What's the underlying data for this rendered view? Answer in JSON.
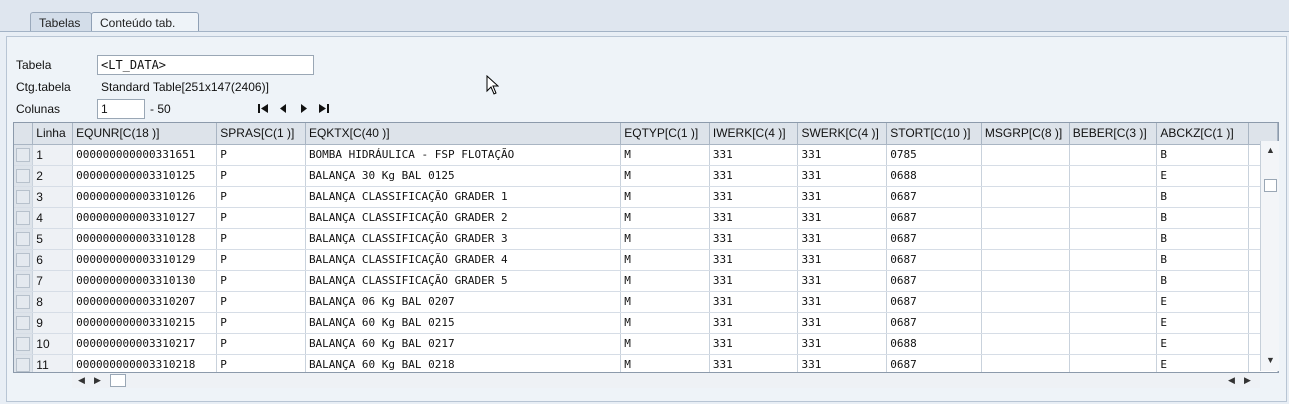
{
  "tabs": [
    {
      "label": "Tabelas"
    },
    {
      "label": "Conteúdo tab."
    }
  ],
  "form": {
    "tabela_label": "Tabela",
    "tabela_value": "<LT_DATA>",
    "ctg_label": "Ctg.tabela",
    "ctg_value": "Standard Table[251x147(2406)]",
    "colunas_label": "Colunas",
    "colunas_value": "1",
    "colunas_to": "-  50"
  },
  "nav_icons": [
    "first-icon",
    "prev-icon",
    "next-icon",
    "last-icon"
  ],
  "table": {
    "columns": [
      "Linha",
      "EQUNR[C(18 )]",
      "SPRAS[C(1 )]",
      "EQKTX[C(40 )]",
      "EQTYP[C(1 )]",
      "IWERK[C(4 )]",
      "SWERK[C(4 )]",
      "STORT[C(10 )]",
      "MSGRP[C(8 )]",
      "BEBER[C(3 )]",
      "ABCKZ[C(1 )]"
    ],
    "rows": [
      [
        "1",
        "000000000000331651",
        "P",
        "BOMBA HIDRÁULICA - FSP FLOTAÇÃO",
        "M",
        "331",
        "331",
        "0785",
        "",
        "",
        "B"
      ],
      [
        "2",
        "000000000003310125",
        "P",
        "BALANÇA 30 Kg BAL 0125",
        "M",
        "331",
        "331",
        "0688",
        "",
        "",
        "E"
      ],
      [
        "3",
        "000000000003310126",
        "P",
        "BALANÇA CLASSIFICAÇÃO GRADER 1",
        "M",
        "331",
        "331",
        "0687",
        "",
        "",
        "B"
      ],
      [
        "4",
        "000000000003310127",
        "P",
        "BALANÇA CLASSIFICAÇÃO GRADER 2",
        "M",
        "331",
        "331",
        "0687",
        "",
        "",
        "B"
      ],
      [
        "5",
        "000000000003310128",
        "P",
        "BALANÇA CLASSIFICAÇÃO GRADER 3",
        "M",
        "331",
        "331",
        "0687",
        "",
        "",
        "B"
      ],
      [
        "6",
        "000000000003310129",
        "P",
        "BALANÇA CLASSIFICAÇÃO GRADER 4",
        "M",
        "331",
        "331",
        "0687",
        "",
        "",
        "B"
      ],
      [
        "7",
        "000000000003310130",
        "P",
        "BALANÇA CLASSIFICAÇÃO GRADER 5",
        "M",
        "331",
        "331",
        "0687",
        "",
        "",
        "B"
      ],
      [
        "8",
        "000000000003310207",
        "P",
        "BALANÇA 06 Kg BAL 0207",
        "M",
        "331",
        "331",
        "0687",
        "",
        "",
        "E"
      ],
      [
        "9",
        "000000000003310215",
        "P",
        "BALANÇA 60 Kg BAL 0215",
        "M",
        "331",
        "331",
        "0687",
        "",
        "",
        "E"
      ],
      [
        "10",
        "000000000003310217",
        "P",
        "BALANÇA 60 Kg BAL 0217",
        "M",
        "331",
        "331",
        "0688",
        "",
        "",
        "E"
      ],
      [
        "11",
        "000000000003310218",
        "P",
        "BALANÇA 60 Kg BAL 0218",
        "M",
        "331",
        "331",
        "0687",
        "",
        "",
        "E"
      ]
    ]
  },
  "colors": {
    "background": "#e8eef5",
    "header": "#dde3ea",
    "border": "#8c9aab"
  }
}
